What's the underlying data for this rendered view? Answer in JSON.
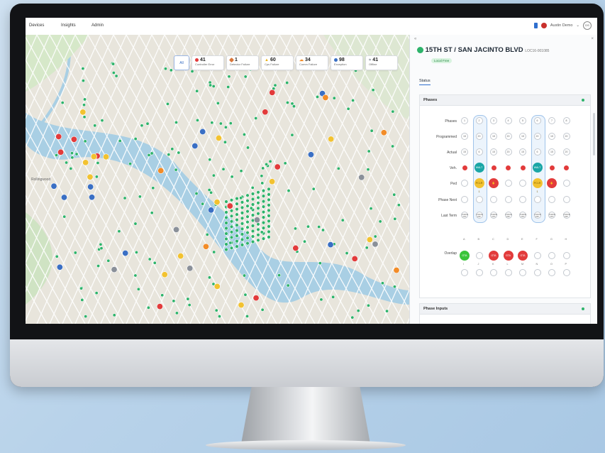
{
  "nav": {
    "items": [
      "Devices",
      "Insights",
      "Admin"
    ],
    "account": "Austin Demo",
    "avatar": "DS"
  },
  "map": {
    "labels": [
      "Rollingwood"
    ],
    "filters": [
      {
        "label": "All",
        "count": "",
        "color": ""
      },
      {
        "label": "Controller Error",
        "count": "41",
        "color": "#e23b3b"
      },
      {
        "label": "Detector Failure",
        "count": "1",
        "color": "#d9773a"
      },
      {
        "label": "Cps Failure",
        "count": "60",
        "color": "#e9b21a"
      },
      {
        "label": "Comm Failure",
        "count": "34",
        "color": "#f28c28"
      },
      {
        "label": "Exception",
        "count": "98",
        "color": "#3a6fc4"
      },
      {
        "label": "Offline",
        "count": "41",
        "color": "#6b7480"
      }
    ]
  },
  "panel": {
    "title": "15TH ST / SAN JACINTO BLVD",
    "id": "LOC16-001085",
    "badge": "Local Free",
    "tab": "Status",
    "card_title": "Phases",
    "card2_title": "Phase Inputs",
    "rows": [
      "Phases",
      "Programmed",
      "Actual",
      "Veh.",
      "Ped",
      "Phase Next",
      "Last Term",
      "Overlap"
    ],
    "phases": [
      "1",
      "2",
      "3",
      "4",
      "5",
      "6",
      "7",
      "8"
    ],
    "programmed": [
      "15",
      "20",
      "15",
      "20",
      "15",
      "20",
      "15",
      "20"
    ],
    "actual": [
      "15",
      "6",
      "15",
      "20",
      "15",
      "6",
      "15",
      "20"
    ],
    "veh_text": [
      "",
      "WALT 12",
      "",
      "",
      "",
      "WALT 12",
      "",
      ""
    ],
    "ped_text": [
      "",
      "PCLR 1",
      "",
      "",
      "",
      "PCLR 1",
      "",
      ""
    ],
    "last_term": [
      "FORCE OFF",
      "FORCE OFF",
      "FORCE OFF",
      "FORCE OFF",
      "FORCE OFF",
      "FORCE OFF",
      "FORCE OFF",
      "FORCE OFF"
    ],
    "overlap_top": [
      "A",
      "B",
      "C",
      "D",
      "E",
      "F",
      "G",
      "H"
    ],
    "overlap_bottom": [
      "I",
      "J",
      "K",
      "L",
      "M",
      "N",
      "O",
      "P"
    ],
    "overlap_text": [
      "GTA 0+0",
      "",
      "GTA 7+0",
      "GTA 0+4",
      "GTA 7+8",
      "",
      "",
      ""
    ]
  },
  "colors": {
    "green": "#2db36a",
    "red": "#e23b3b",
    "teal": "#1aa6a6",
    "yellow": "#f2c230",
    "blue": "#3a6fc4"
  }
}
